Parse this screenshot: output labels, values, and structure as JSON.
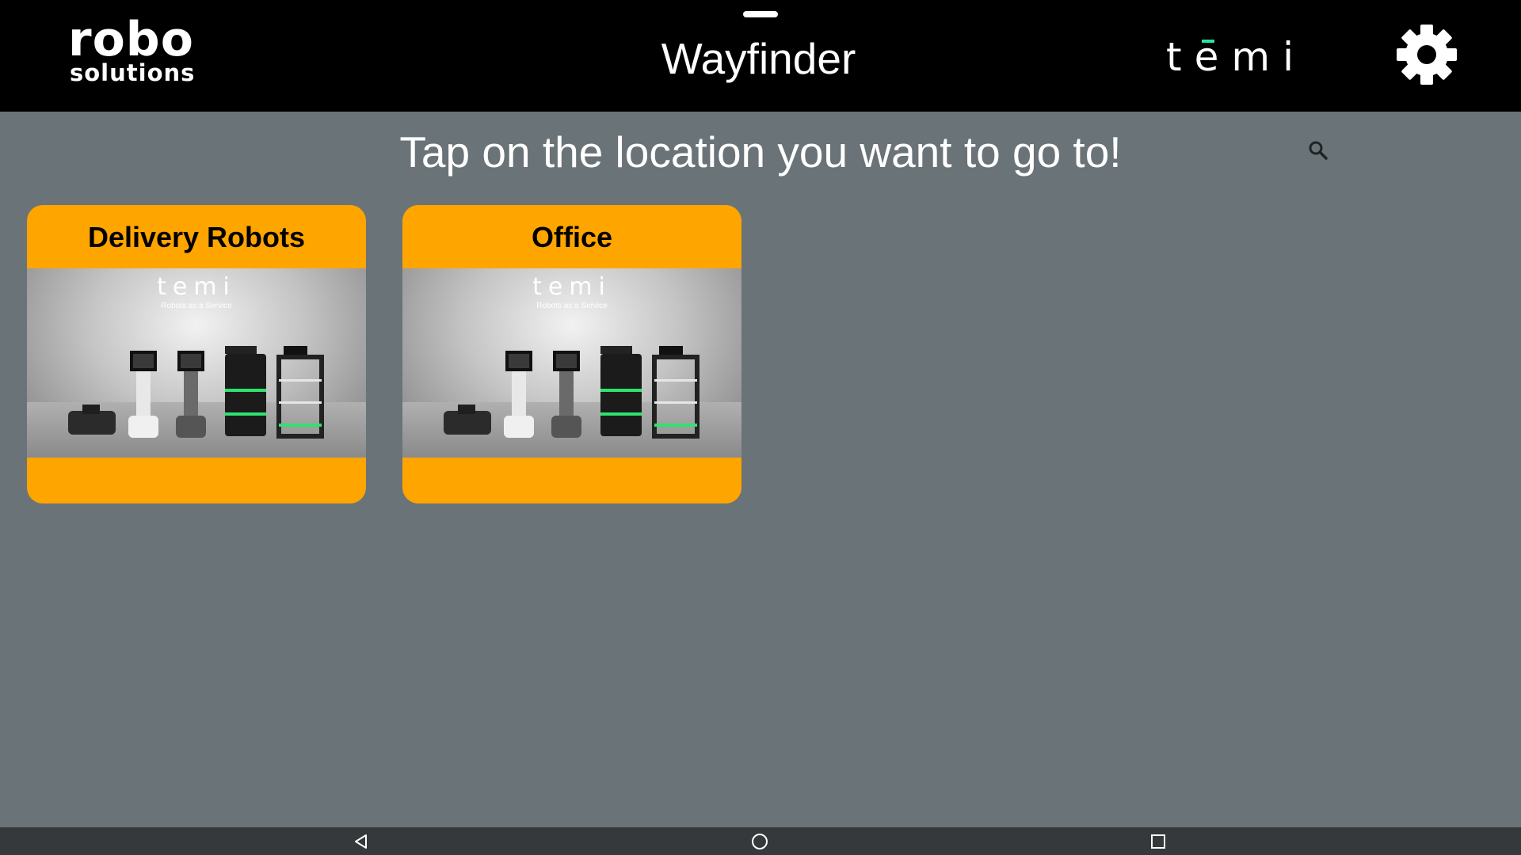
{
  "header": {
    "brand_line1": "robo",
    "brand_line2": "solutions",
    "title": "Wayfinder",
    "partner_logo": "temi"
  },
  "icons": {
    "settings": "gear-icon",
    "search": "search-icon",
    "back": "back-triangle-icon",
    "home": "home-circle-icon",
    "recents": "recents-square-icon"
  },
  "main": {
    "instruction": "Tap on the location you want to go to!",
    "locations": [
      {
        "label": "Delivery Robots",
        "image_brand": "temi",
        "image_tagline": "Robots as a Service"
      },
      {
        "label": "Office",
        "image_brand": "temi",
        "image_tagline": "Robots as a Service"
      }
    ]
  },
  "colors": {
    "accent": "#ffa500",
    "background": "#6a7377",
    "topbar": "#000000",
    "temi_accent": "#2ee3a0"
  }
}
